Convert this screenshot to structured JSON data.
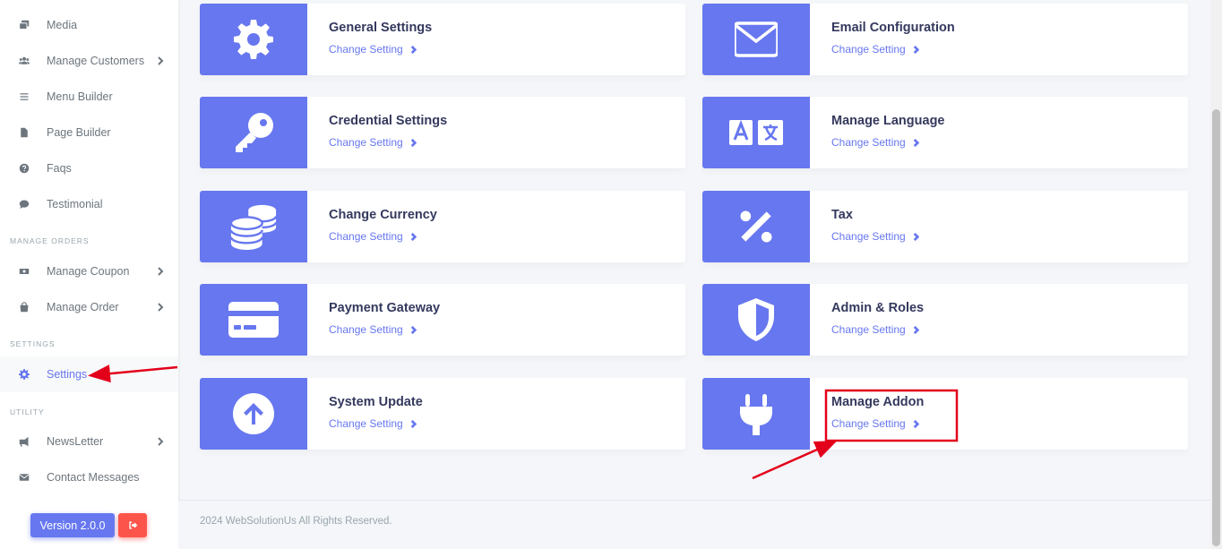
{
  "sidebar": {
    "items": [
      {
        "label": "Media",
        "icon": "images-icon",
        "chevron": false
      },
      {
        "label": "Manage Customers",
        "icon": "users-icon",
        "chevron": true
      },
      {
        "label": "Menu Builder",
        "icon": "bars-icon",
        "chevron": false
      },
      {
        "label": "Page Builder",
        "icon": "file-icon",
        "chevron": false
      },
      {
        "label": "Faqs",
        "icon": "question-circle-icon",
        "chevron": false
      },
      {
        "label": "Testimonial",
        "icon": "comment-icon",
        "chevron": false
      }
    ],
    "header_orders": "MANAGE ORDERS",
    "orders_items": [
      {
        "label": "Manage Coupon",
        "icon": "ticket-icon",
        "chevron": true
      },
      {
        "label": "Manage Order",
        "icon": "shopping-bag-icon",
        "chevron": true
      }
    ],
    "header_settings": "SETTINGS",
    "settings_item": {
      "label": "Settings",
      "icon": "gear-icon",
      "active": true
    },
    "header_utility": "UTILITY",
    "utility_items": [
      {
        "label": "NewsLetter",
        "icon": "bullhorn-icon",
        "chevron": true
      },
      {
        "label": "Contact Messages",
        "icon": "envelope-icon",
        "chevron": false
      }
    ],
    "version_label": "Version 2.0.0",
    "logout_icon": "sign-out-icon"
  },
  "settings_cards": [
    {
      "title": "General Settings",
      "link": "Change Setting",
      "icon": "gear-icon"
    },
    {
      "title": "Email Configuration",
      "link": "Change Setting",
      "icon": "envelope-icon"
    },
    {
      "title": "Credential Settings",
      "link": "Change Setting",
      "icon": "key-icon"
    },
    {
      "title": "Manage Language",
      "link": "Change Setting",
      "icon": "language-icon"
    },
    {
      "title": "Change Currency",
      "link": "Change Setting",
      "icon": "coins-icon"
    },
    {
      "title": "Tax",
      "link": "Change Setting",
      "icon": "percent-icon"
    },
    {
      "title": "Payment Gateway",
      "link": "Change Setting",
      "icon": "credit-card-icon"
    },
    {
      "title": "Admin & Roles",
      "link": "Change Setting",
      "icon": "shield-icon"
    },
    {
      "title": "System Update",
      "link": "Change Setting",
      "icon": "arrow-up-circle-icon"
    },
    {
      "title": "Manage Addon",
      "link": "Change Setting",
      "icon": "plug-icon"
    }
  ],
  "footer": {
    "copyright": "2024 WebSolutionUs All Rights Reserved."
  },
  "colors": {
    "accent": "#6777ef",
    "danger": "#fc544b",
    "annotation": "#e3001b"
  }
}
